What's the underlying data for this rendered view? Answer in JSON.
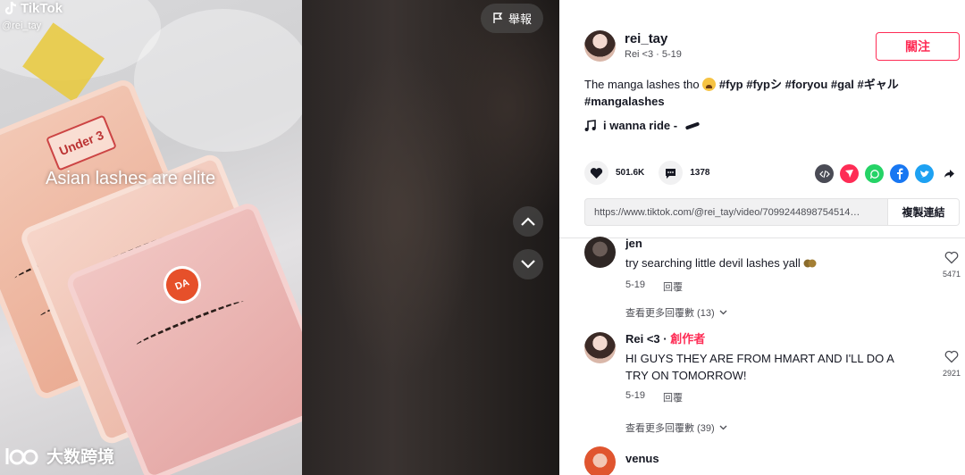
{
  "video": {
    "logo_text": "TikTok",
    "handle": "@rei_tay",
    "overlay_caption": "Asian lashes are elite",
    "box_label": "Under 3",
    "box_brand": "DA",
    "watermark_text": "大数跨境",
    "report_label": "舉報"
  },
  "author": {
    "username": "rei_tay",
    "subtitle": "Rei <3 · 5-19",
    "follow_label": "關注"
  },
  "description": {
    "text": "The manga lashes tho",
    "hashtags": [
      "#fyp",
      "#fypシ",
      "#foryou",
      "#gal",
      "#ギャル",
      "#mangalashes"
    ]
  },
  "music": {
    "title": "i wanna ride -"
  },
  "stats": {
    "likes": "501.6K",
    "comments": "1378"
  },
  "share": {
    "icons": [
      "embed-icon",
      "send-icon",
      "whatsapp-icon",
      "facebook-icon",
      "twitter-icon",
      "share-arrow-icon"
    ],
    "colors": {
      "embed": "#4a4b55",
      "send": "#fe2c55",
      "whatsapp": "#25d366",
      "facebook": "#1877f2",
      "twitter": "#1da1f2"
    }
  },
  "link": {
    "url": "https://www.tiktok.com/@rei_tay/video/7099244898754514…",
    "copy_label": "複製連結"
  },
  "comments": [
    {
      "name": "jen",
      "creator_badge": "",
      "text": "try searching little devil lashes yall",
      "date": "5-19",
      "reply_label": "回覆",
      "likes": "5471",
      "more_replies": "查看更多回覆數 (13)"
    },
    {
      "name": "Rei <3",
      "creator_badge": "創作者",
      "text": "HI GUYS THEY ARE FROM HMART AND I'LL DO A TRY ON TOMORROW!",
      "date": "5-19",
      "reply_label": "回覆",
      "likes": "2921",
      "more_replies": "查看更多回覆數 (39)"
    },
    {
      "name": "venus",
      "creator_badge": "",
      "text": "",
      "date": "",
      "reply_label": "",
      "likes": "",
      "more_replies": ""
    }
  ],
  "colors": {
    "accent": "#fe2c55",
    "text_primary": "#161823",
    "text_secondary": "#4d4e55"
  }
}
